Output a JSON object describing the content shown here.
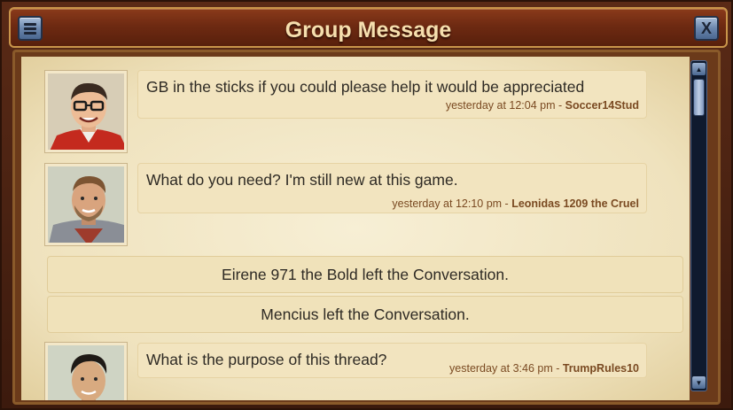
{
  "window": {
    "title": "Group Message",
    "close_label": "X"
  },
  "messages": [
    {
      "text": "GB in the sticks if you could please help it would be appreciated",
      "time": "yesterday at 12:04 pm - ",
      "author": "Soccer14Stud",
      "avatar": "avatar-glasses-man-red-hoodie"
    },
    {
      "text": "What do you need? I'm still new at this game.",
      "time": "yesterday at 12:10 pm - ",
      "author": "Leonidas 1209 the Cruel",
      "avatar": "avatar-bearded-knight"
    },
    {
      "text": "What is the purpose of this thread?",
      "time": "yesterday at 3:46 pm - ",
      "author": "TrumpRules10",
      "avatar": "avatar-young-man"
    }
  ],
  "system_notices": [
    "Eirene 971 the Bold left the Conversation.",
    "Mencius left the Conversation."
  ],
  "colors": {
    "title_text": "#f6dfae",
    "meta_text": "#7a4a22",
    "parchment": "#f2e4bf"
  }
}
